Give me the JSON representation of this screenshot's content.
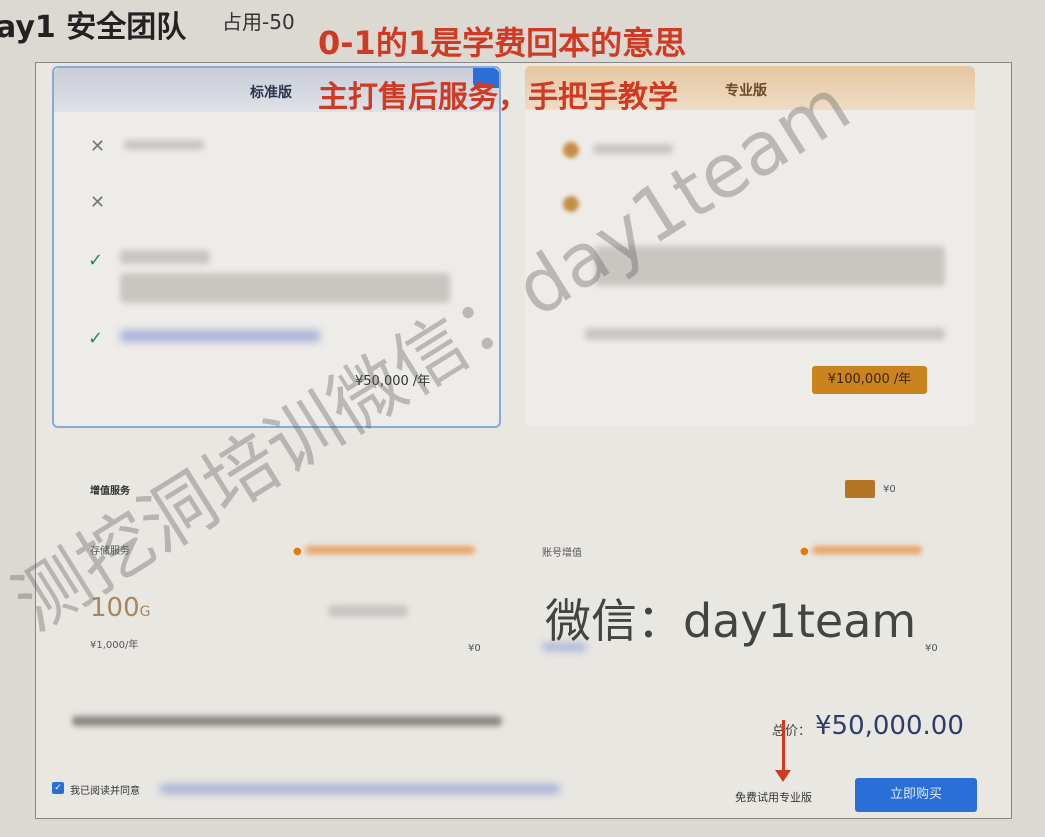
{
  "header": {
    "title": "ay1 安全团队",
    "occupy": "占用-50"
  },
  "annotations": {
    "line1": "0-1的1是学费回本的意思",
    "line2": "主打售后服务，手把手教学",
    "watermark": "测挖洞培训微信：day1team",
    "wechat": "微信：day1team"
  },
  "plans": [
    {
      "name": "标准版",
      "price": "¥50,000 /年"
    },
    {
      "name": "专业版",
      "price": "¥100,000 /年"
    }
  ],
  "addons": {
    "title": "增值服务",
    "storage": {
      "label": "存储服务",
      "value": "100",
      "unit": "G",
      "unit_price": "¥1,000/年",
      "subtotal": "¥0"
    },
    "account": {
      "label": "账号增值",
      "subtotal": "¥0"
    },
    "toggle_value": "¥0"
  },
  "footer": {
    "total_label": "总价：",
    "total": "¥50,000.00",
    "agree": "我已阅读并同意",
    "trial": "免费试用专业版",
    "buy": "立即购买"
  }
}
